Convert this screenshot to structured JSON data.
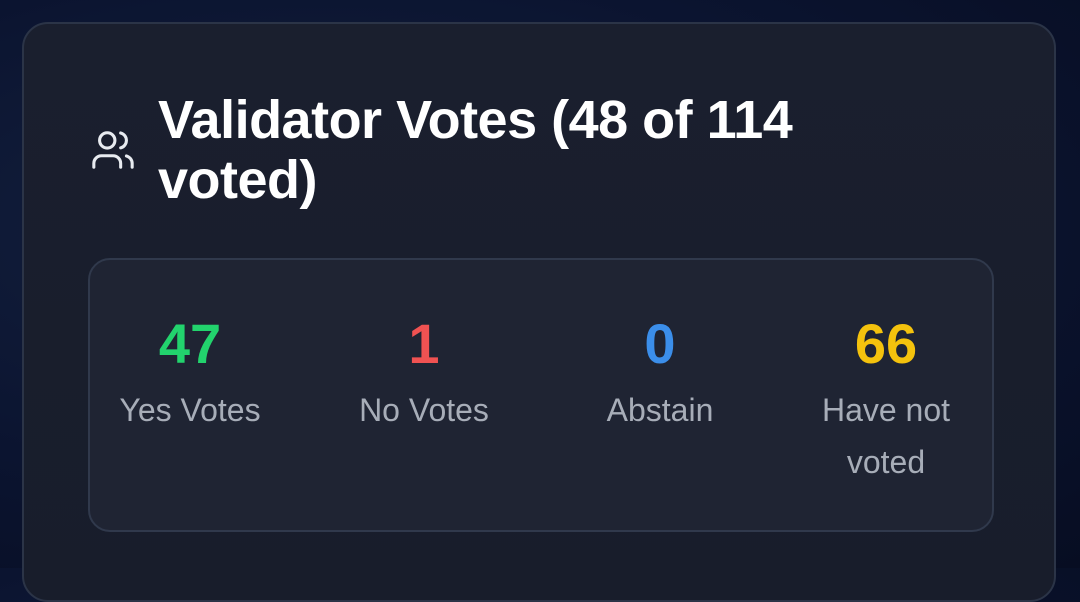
{
  "panel": {
    "title": "Validator Votes (48 of 114 voted)",
    "icon": "users-icon"
  },
  "stats": [
    {
      "value": "47",
      "label": "Yes Votes",
      "color": "#22d36d"
    },
    {
      "value": "1",
      "label": "No Votes",
      "color": "#f05252"
    },
    {
      "value": "0",
      "label": "Abstain",
      "color": "#3b8eea"
    },
    {
      "value": "66",
      "label": "Have not voted",
      "color": "#f4c20d"
    }
  ]
}
